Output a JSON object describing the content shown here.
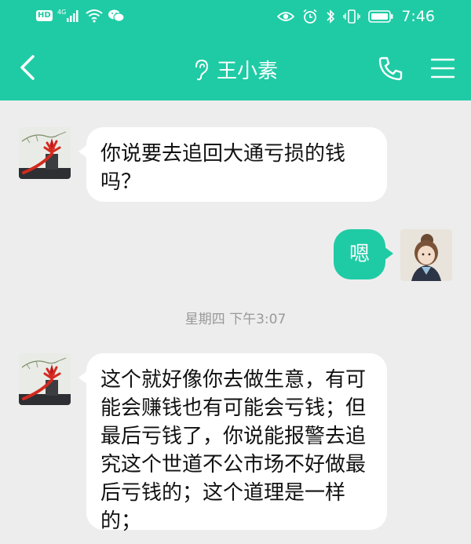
{
  "status_bar": {
    "left_badge": "HD",
    "network": "4G",
    "time": "7:46",
    "icons_left": [
      "hd-icon",
      "signal-icon",
      "wifi-icon",
      "wechat-icon"
    ],
    "icons_right": [
      "eye-icon",
      "alarm-icon",
      "bluetooth-icon",
      "vibrate-icon",
      "battery-icon"
    ]
  },
  "header": {
    "title": "王小素",
    "icons": [
      "back-icon",
      "ear-icon",
      "phone-icon",
      "menu-icon"
    ]
  },
  "messages": [
    {
      "side": "left",
      "text": "你说要去追回大通亏损的钱吗？"
    },
    {
      "side": "right",
      "text": "嗯"
    },
    {
      "side": "left",
      "text": "这个就好像你去做生意，有可能会赚钱也有可能会亏钱；但最后亏钱了，你说能报警去追究这个世道不公市场不好做最后亏钱的；这个道理是一样的；"
    }
  ],
  "timestamp": "星期四 下午3:07",
  "colors": {
    "accent": "#1fcba5",
    "background": "#ededed",
    "bubble": "#ffffff"
  }
}
